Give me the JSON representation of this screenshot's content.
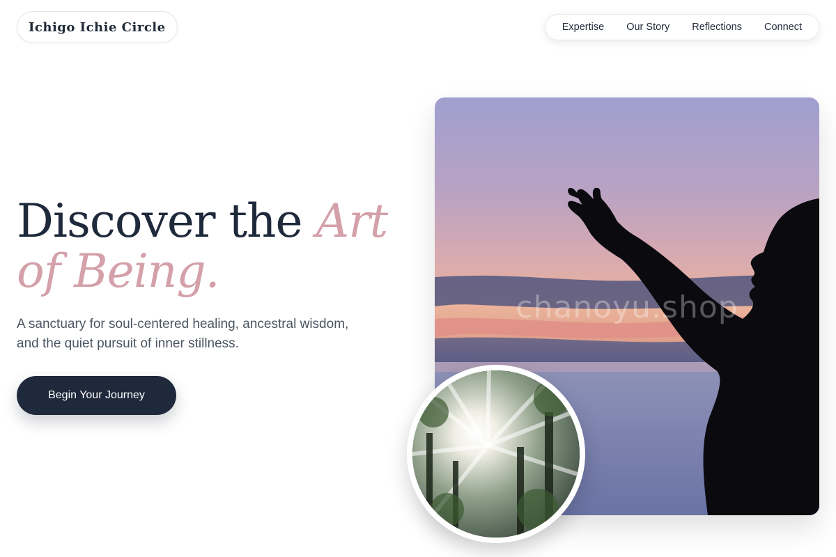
{
  "brand": {
    "name": "Ichigo Ichie Circle"
  },
  "nav": {
    "items": [
      {
        "label": "Expertise"
      },
      {
        "label": "Our Story"
      },
      {
        "label": "Reflections"
      },
      {
        "label": "Connect"
      }
    ]
  },
  "hero": {
    "title_part1": "Discover the ",
    "title_accent": "Art of Being.",
    "subtitle": "A sanctuary for soul-centered healing, ancestral wisdom, and the quiet pursuit of inner stillness.",
    "cta_label": "Begin Your Journey"
  },
  "media": {
    "main_watermark": "chanoyu.shop"
  },
  "colors": {
    "primary_dark": "#1e293b",
    "accent_pink": "#d4a0a9",
    "body_text": "#4b5563"
  }
}
